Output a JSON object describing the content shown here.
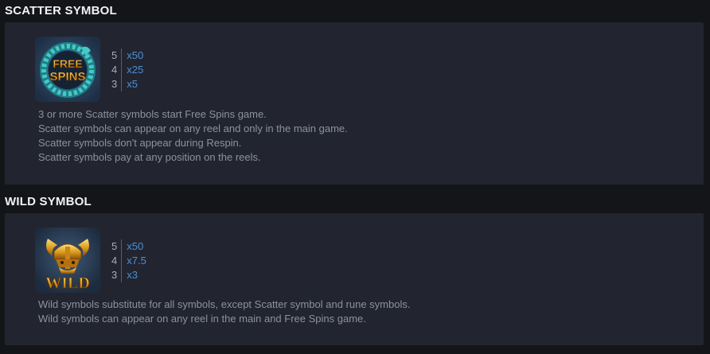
{
  "scatter": {
    "header": "SCATTER SYMBOL",
    "icon": "free-spins-scatter-icon",
    "icon_text": "FREE SPINS",
    "payouts": [
      {
        "count": "5",
        "multiplier": "x50"
      },
      {
        "count": "4",
        "multiplier": "x25"
      },
      {
        "count": "3",
        "multiplier": "x5"
      }
    ],
    "description": [
      "3 or more Scatter symbols start Free Spins game.",
      "Scatter symbols can appear on any reel and only in the main game.",
      "Scatter symbols don't appear during Respin.",
      "Scatter symbols pay at any position on the reels."
    ]
  },
  "wild": {
    "header": "WILD SYMBOL",
    "icon": "viking-helmet-wild-icon",
    "icon_text": "WILD",
    "payouts": [
      {
        "count": "5",
        "multiplier": "x50"
      },
      {
        "count": "4",
        "multiplier": "x7.5"
      },
      {
        "count": "3",
        "multiplier": "x3"
      }
    ],
    "description": [
      "Wild symbols substitute for all symbols, except Scatter symbol and rune symbols.",
      "Wild symbols can appear on any reel in the main and Free Spins game."
    ]
  },
  "colors": {
    "background": "#141519",
    "panel": "#22252f",
    "multiplier": "#4c8fd6",
    "description": "#8a91a0"
  }
}
